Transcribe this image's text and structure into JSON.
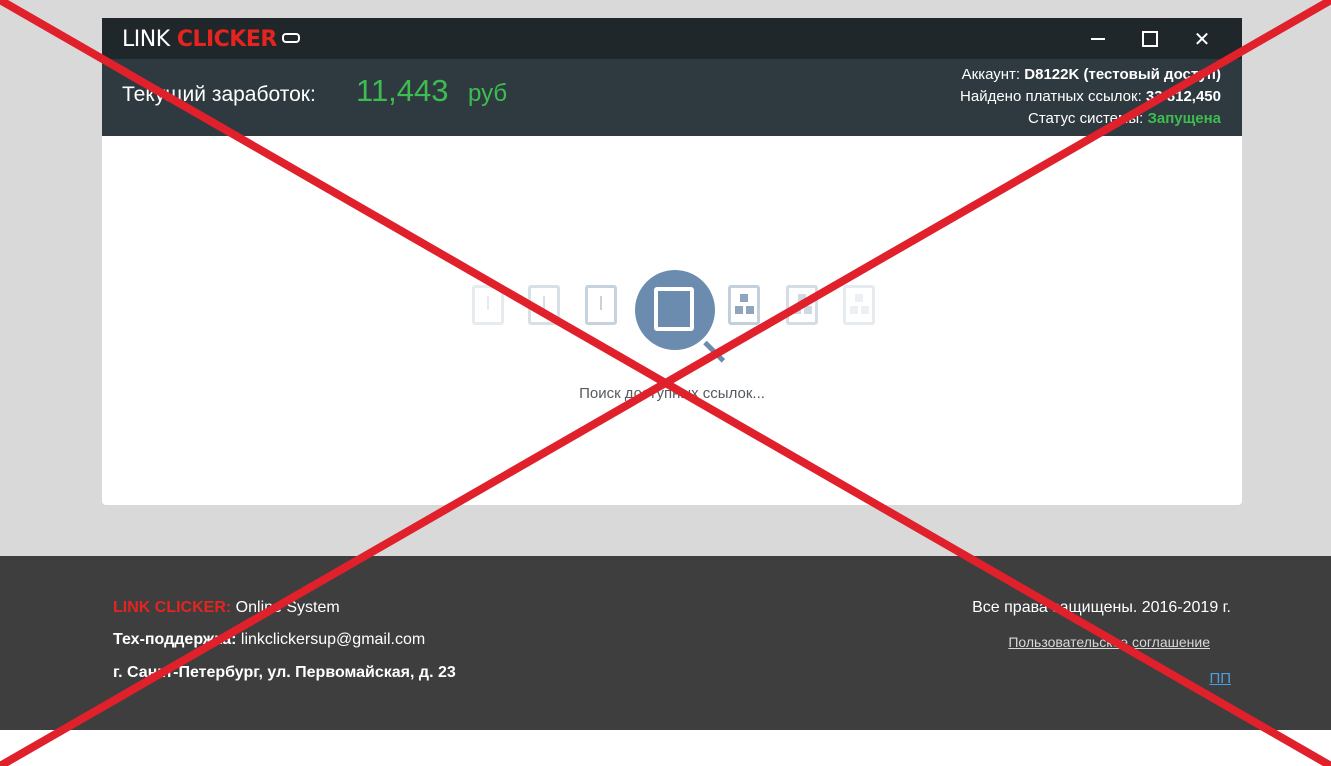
{
  "window": {
    "logo_part1": "LINK",
    "logo_part2": "CLICKER",
    "controls": {
      "minimize_icon": "minimize-icon",
      "maximize_icon": "maximize-icon",
      "close_icon": "close-icon",
      "close_glyph": "✕"
    }
  },
  "status": {
    "earnings_label": "Текущий заработок:",
    "earnings_value": "11,443",
    "earnings_currency": "руб",
    "account_label": "Аккаунт:",
    "account_value": "D8122K (тестовый доступ)",
    "links_label": "Найдено платных ссылок:",
    "links_value": "33 812,450",
    "system_label": "Статус системы:",
    "system_value": "Запущена"
  },
  "search": {
    "text": "Поиск доступных ссылок..."
  },
  "footer": {
    "brand": "LINK CLICKER:",
    "brand_suffix": " Online System",
    "support_label": "Тех-поддержка:",
    "support_email": " linkclickersup@gmail.com",
    "address": "г. Санкт-Петербург, ул. Первомайская, д. 23",
    "rights": "Все права защищены. 2016-2019 г.",
    "agreement_link": "Пользовательское соглашение",
    "pp_link": "ПП"
  },
  "colors": {
    "accent_red": "#e52420",
    "accent_green": "#3dbd4f",
    "titlebar": "#1f272b",
    "statusbar": "#2f3a40",
    "footer_bg": "#3e3e3e",
    "cross": "#e0202a"
  }
}
